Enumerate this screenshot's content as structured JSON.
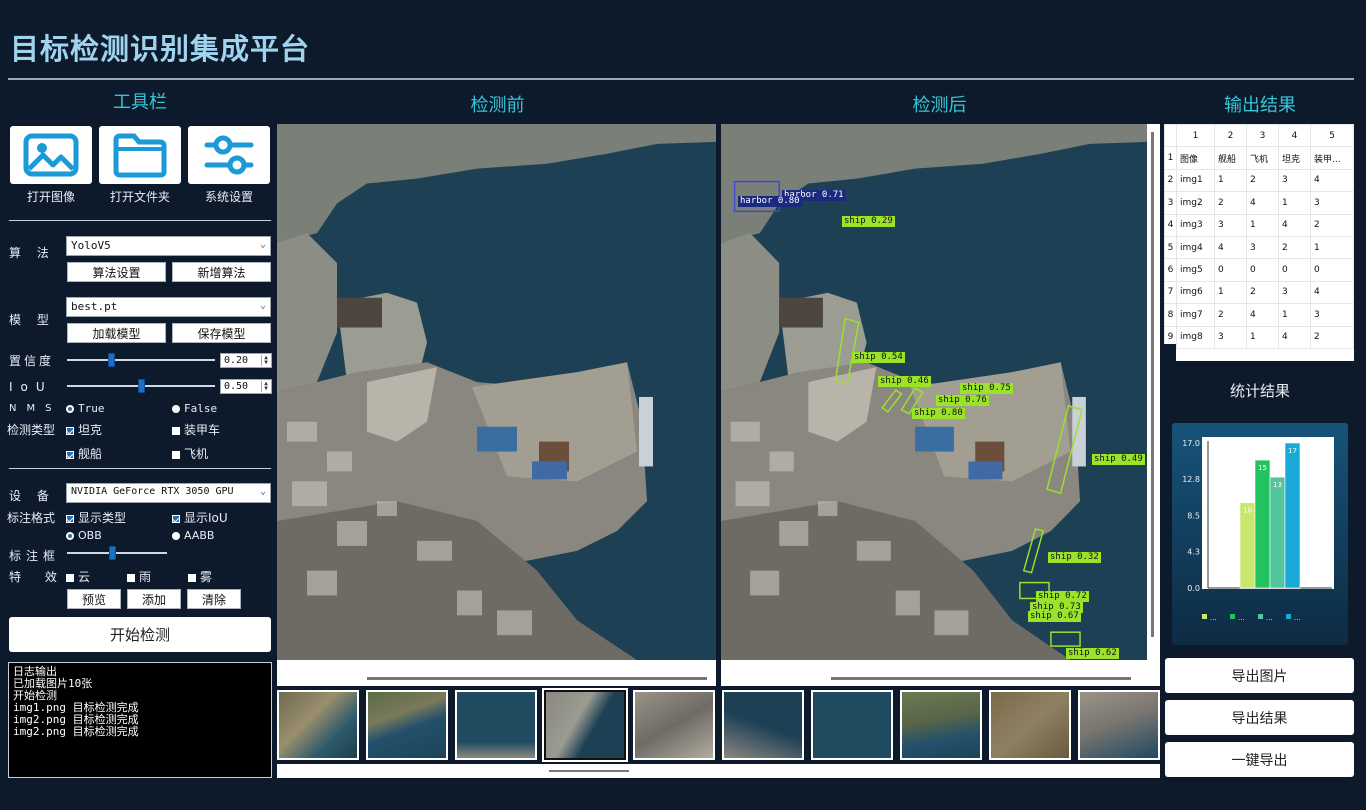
{
  "app_title": "目标检测识别集成平台",
  "toolbar": {
    "title": "工具栏",
    "buttons": [
      {
        "label": "打开图像",
        "icon": "image-icon"
      },
      {
        "label": "打开文件夹",
        "icon": "folder-icon"
      },
      {
        "label": "系统设置",
        "icon": "settings-sliders-icon"
      }
    ]
  },
  "algorithm": {
    "label": "算 法",
    "value": "YoloV5",
    "settings_button": "算法设置",
    "add_button": "新增算法"
  },
  "model": {
    "label": "模 型",
    "value": "best.pt",
    "load_button": "加载模型",
    "save_button": "保存模型"
  },
  "confidence": {
    "label": "置信度",
    "value": "0.20",
    "fraction": 0.3
  },
  "iou": {
    "label": "IoU",
    "value": "0.50",
    "fraction": 0.5
  },
  "nms": {
    "label": "NMS",
    "options": [
      "True",
      "False"
    ],
    "selected": "True"
  },
  "detect_types": {
    "label": "检测类型",
    "options": [
      {
        "label": "坦克",
        "checked": true
      },
      {
        "label": "装甲车",
        "checked": false
      },
      {
        "label": "舰船",
        "checked": true
      },
      {
        "label": "飞机",
        "checked": false
      }
    ]
  },
  "device": {
    "label": "设 备",
    "value": "NVIDIA GeForce RTX 3050 GPU"
  },
  "annotation_format": {
    "label": "标注格式",
    "show_type": "显示类型",
    "show_iou": "显示IoU",
    "box_options": [
      "OBB",
      "AABB"
    ],
    "selected_box": "OBB"
  },
  "box_size": {
    "label": "标注框",
    "fraction": 0.45
  },
  "effects": {
    "label": "特 效",
    "options": [
      "云",
      "雨",
      "雾"
    ],
    "buttons": [
      "预览",
      "添加",
      "清除"
    ]
  },
  "start_button": "开始检测",
  "log": {
    "lines": [
      "日志输出",
      "已加载图片10张",
      "开始检测",
      "img1.png 目标检测完成",
      "img2.png 目标检测完成",
      "img2.png 目标检测完成"
    ]
  },
  "before_title": "检测前",
  "after_title": "检测后",
  "detections": [
    {
      "label": "harbor 0.71"
    },
    {
      "label": "harbor 0.80"
    },
    {
      "label": "ship 0.29"
    },
    {
      "label": "ship 0.54"
    },
    {
      "label": "ship 0.46"
    },
    {
      "label": "ship 0.75"
    },
    {
      "label": "ship 0.76"
    },
    {
      "label": "ship 0.80"
    },
    {
      "label": "ship 0.49"
    },
    {
      "label": "ship 0.32"
    },
    {
      "label": "ship 0.72"
    },
    {
      "label": "ship 0.73"
    },
    {
      "label": "ship 0.67"
    },
    {
      "label": "ship 0.62"
    }
  ],
  "output": {
    "title": "输出结果",
    "col_numbers": [
      "1",
      "2",
      "3",
      "4",
      "5"
    ],
    "headers": [
      "图像",
      "舰船",
      "飞机",
      "坦克",
      "装甲..."
    ],
    "rows": [
      [
        "img1",
        "1",
        "2",
        "3",
        "4"
      ],
      [
        "img2",
        "2",
        "4",
        "1",
        "3"
      ],
      [
        "img3",
        "3",
        "1",
        "4",
        "2"
      ],
      [
        "img4",
        "4",
        "3",
        "2",
        "1"
      ],
      [
        "img5",
        "0",
        "0",
        "0",
        "0"
      ],
      [
        "img6",
        "1",
        "2",
        "3",
        "4"
      ],
      [
        "img7",
        "2",
        "4",
        "1",
        "3"
      ],
      [
        "img8",
        "3",
        "1",
        "4",
        "2"
      ]
    ],
    "row_numbers": [
      "1",
      "2",
      "3",
      "4",
      "5",
      "6",
      "7",
      "8",
      "9"
    ]
  },
  "stats_title": "统计结果",
  "chart_data": {
    "type": "bar",
    "values": [
      10,
      15,
      13,
      17
    ],
    "colors": [
      "#c8e86b",
      "#22c35e",
      "#52c4a0",
      "#1aa8d6"
    ],
    "yticks": [
      "17.0",
      "12.8",
      "8.5",
      "4.3",
      "0.0"
    ],
    "ylim": [
      0,
      17
    ],
    "legend": [
      "...",
      "...",
      "...",
      "..."
    ]
  },
  "export": {
    "image": "导出图片",
    "result": "导出结果",
    "all": "一键导出"
  }
}
